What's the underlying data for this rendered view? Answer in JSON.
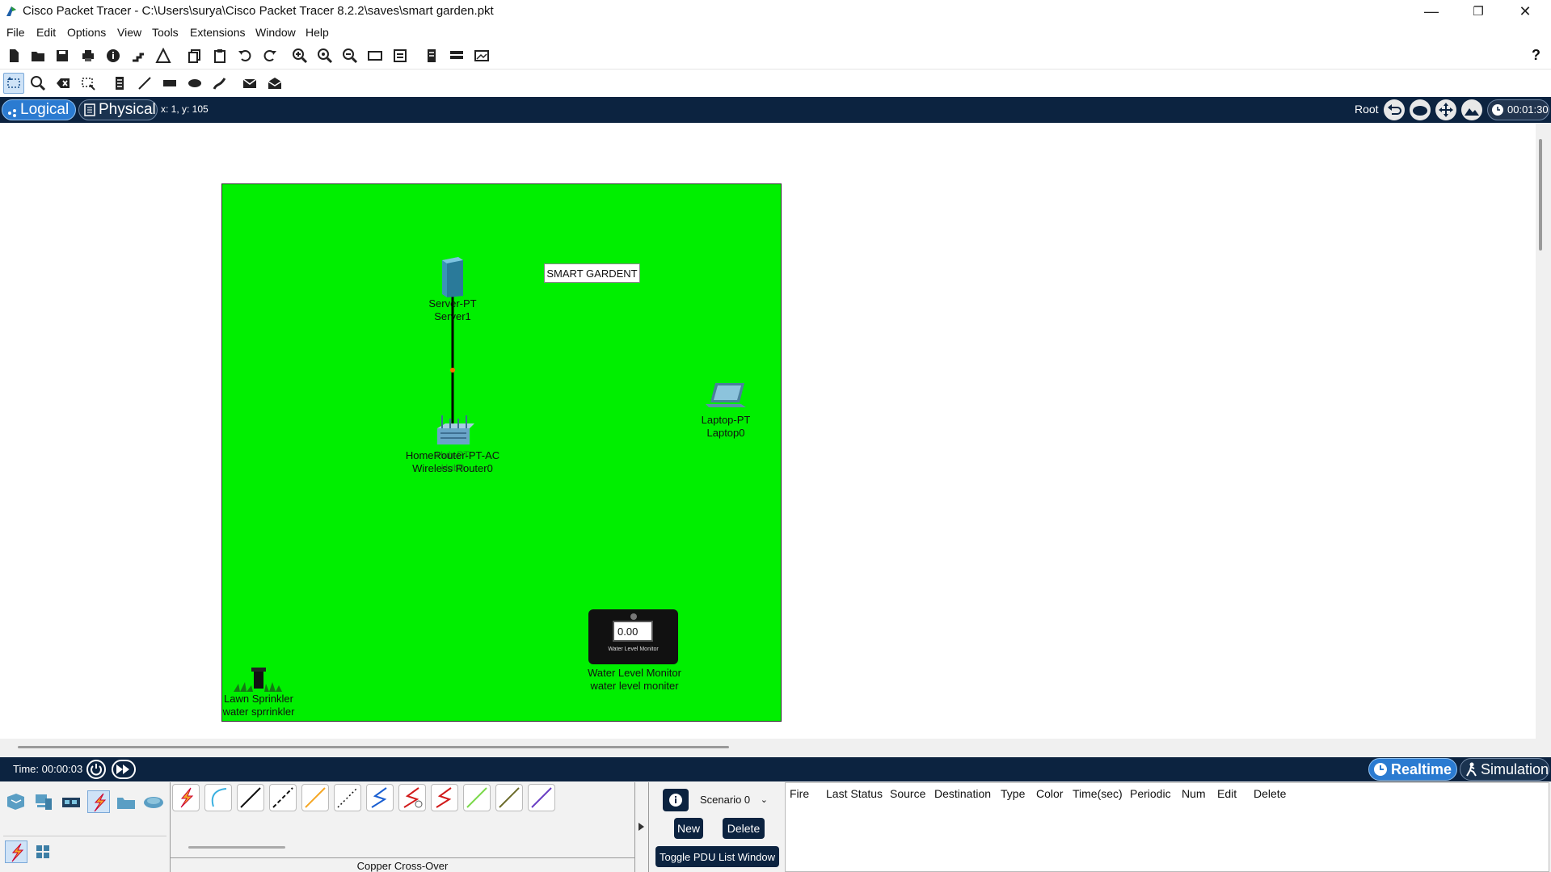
{
  "window": {
    "title": "Cisco Packet Tracer - C:\\Users\\surya\\Cisco Packet Tracer 8.2.2\\saves\\smart garden.pkt",
    "minimize": "—",
    "restore": "❐",
    "close": "✕"
  },
  "menu": [
    "File",
    "Edit",
    "Options",
    "View",
    "Tools",
    "Extensions",
    "Window",
    "Help"
  ],
  "toolbar": {
    "help": "?"
  },
  "viewbar": {
    "logical_label": "Logical",
    "physical_label": "Physical",
    "coords": "x: 1, y: 105",
    "root_label": "Root",
    "clock": "00:01:30"
  },
  "workspace": {
    "note": "SMART GARDENT",
    "devices": {
      "server": {
        "model": "Server-PT",
        "name": "Server1"
      },
      "router": {
        "model": "HomeRouter-PT-AC",
        "name": "Wireless Router0",
        "overlap_model": "Hub-PT",
        "overlap_name": "Hub0"
      },
      "laptop": {
        "model": "Laptop-PT",
        "name": "Laptop0"
      },
      "water_monitor": {
        "model": "Water Level Monitor",
        "name": "water level moniter",
        "display": "0.00",
        "caption": "Water Level Monitor"
      },
      "sprinkler": {
        "model": "Lawn Sprinkler",
        "name": "water sprrinkler"
      }
    }
  },
  "simbar": {
    "time": "Time: 00:00:03",
    "realtime": "Realtime",
    "simulation": "Simulation"
  },
  "device_panel": {
    "selected_cable": "Copper Cross-Over"
  },
  "scenario": {
    "selected": "Scenario 0",
    "new": "New",
    "delete": "Delete",
    "toggle": "Toggle PDU List Window"
  },
  "pdu_columns": [
    "Fire",
    "Last Status",
    "Source",
    "Destination",
    "Type",
    "Color",
    "Time(sec)",
    "Periodic",
    "Num",
    "Edit",
    "Delete"
  ]
}
